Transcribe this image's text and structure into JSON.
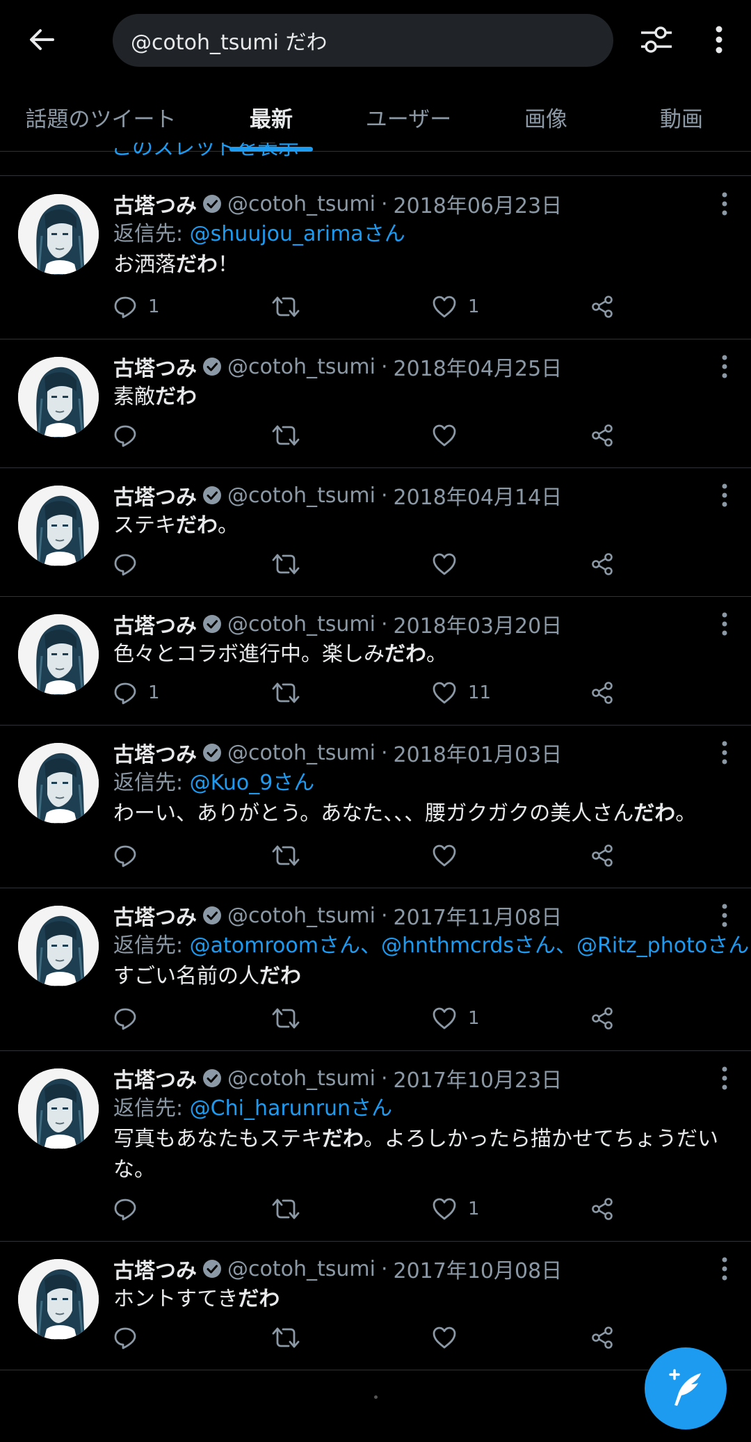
{
  "header": {
    "search_value": "@cotoh_tsumi だわ",
    "back_icon": "back-arrow-icon",
    "filter_icon": "filter-sliders-icon",
    "more_icon": "more-vertical-icon"
  },
  "tabs": [
    {
      "label": "話題のツイート",
      "active": false
    },
    {
      "label": "最新",
      "active": true
    },
    {
      "label": "ユーザー",
      "active": false
    },
    {
      "label": "画像",
      "active": false
    },
    {
      "label": "動画",
      "active": false
    }
  ],
  "partial_tweet_text": "このスレッドを表示",
  "colors": {
    "accent": "#1d9bf0",
    "muted": "#8b98a5",
    "background": "#000000"
  },
  "tweets": [
    {
      "name": "古塔つみ",
      "handle": "@cotoh_tsumi",
      "sep": "·",
      "date": "2018年06月23日",
      "reply_prefix": "返信先: ",
      "reply_to": "@shuujou_arimaさん",
      "text_before": "お洒落",
      "text_bold": "だわ",
      "text_after": "！",
      "replies": "1",
      "retweets": "",
      "likes": "1"
    },
    {
      "name": "古塔つみ",
      "handle": "@cotoh_tsumi",
      "sep": "·",
      "date": "2018年04月25日",
      "reply_prefix": "",
      "reply_to": "",
      "text_before": "素敵",
      "text_bold": "だわ",
      "text_after": "",
      "replies": "",
      "retweets": "",
      "likes": ""
    },
    {
      "name": "古塔つみ",
      "handle": "@cotoh_tsumi",
      "sep": "·",
      "date": "2018年04月14日",
      "reply_prefix": "",
      "reply_to": "",
      "text_before": "ステキ",
      "text_bold": "だわ",
      "text_after": "。",
      "replies": "",
      "retweets": "",
      "likes": ""
    },
    {
      "name": "古塔つみ",
      "handle": "@cotoh_tsumi",
      "sep": "·",
      "date": "2018年03月20日",
      "reply_prefix": "",
      "reply_to": "",
      "text_before": "色々とコラボ進行中。楽しみ",
      "text_bold": "だわ",
      "text_after": "。",
      "replies": "1",
      "retweets": "",
      "likes": "11"
    },
    {
      "name": "古塔つみ",
      "handle": "@cotoh_tsumi",
      "sep": "·",
      "date": "2018年01月03日",
      "reply_prefix": "返信先: ",
      "reply_to": "@Kuo_9さん",
      "text_before": "わーい、ありがとう。あなた、、、腰ガクガクの美人さん",
      "text_bold": "だわ",
      "text_after": "。",
      "replies": "",
      "retweets": "",
      "likes": ""
    },
    {
      "name": "古塔つみ",
      "handle": "@cotoh_tsumi",
      "sep": "·",
      "date": "2017年11月08日",
      "reply_prefix": "返信先: ",
      "reply_to": "@atomroomさん、@hnthmcrdsさん、@Ritz_photoさん",
      "text_before": "すごい名前の人",
      "text_bold": "だわ",
      "text_after": "",
      "replies": "",
      "retweets": "",
      "likes": "1"
    },
    {
      "name": "古塔つみ",
      "handle": "@cotoh_tsumi",
      "sep": "·",
      "date": "2017年10月23日",
      "reply_prefix": "返信先: ",
      "reply_to": "@Chi_harunrunさん",
      "text_before": "写真もあなたもステキ",
      "text_bold": "だわ",
      "text_after": "。よろしかったら描かせてちょうだいな。",
      "replies": "",
      "retweets": "",
      "likes": "1"
    },
    {
      "name": "古塔つみ",
      "handle": "@cotoh_tsumi",
      "sep": "·",
      "date": "2017年10月08日",
      "reply_prefix": "",
      "reply_to": "",
      "text_before": "ホントすてき",
      "text_bold": "だわ",
      "text_after": "",
      "replies": "",
      "retweets": "",
      "likes": ""
    }
  ],
  "fab": {
    "icon": "compose-tweet-icon"
  }
}
